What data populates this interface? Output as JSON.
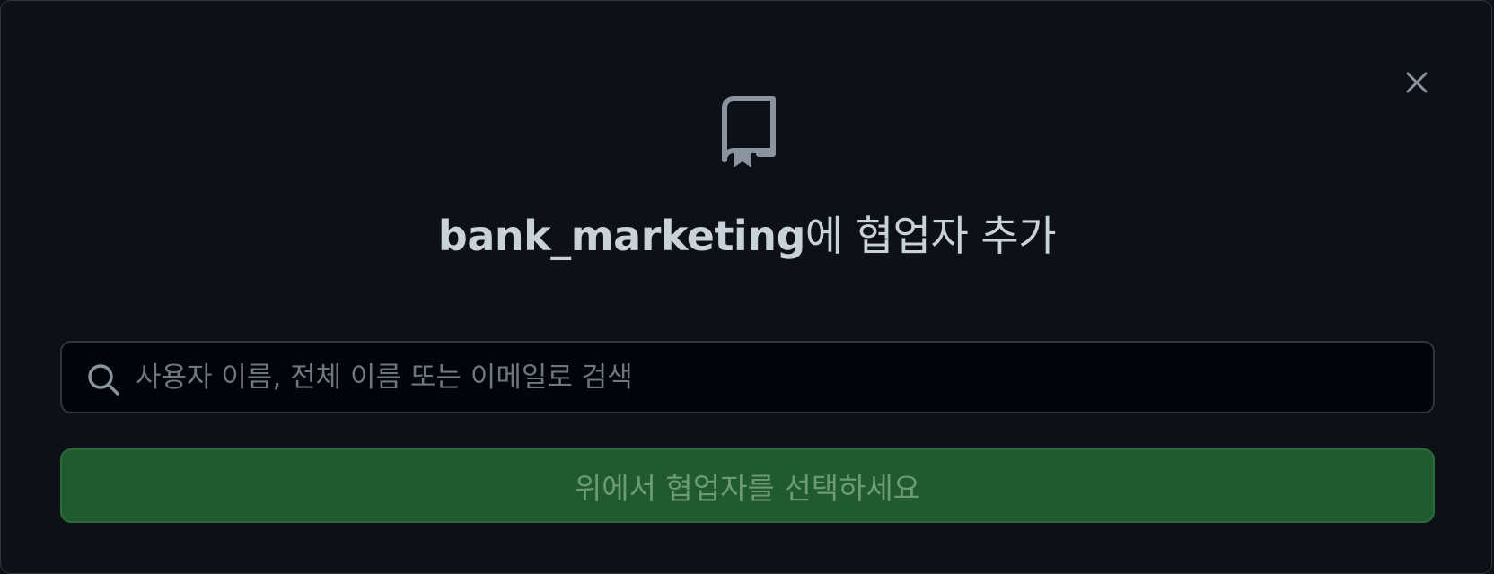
{
  "dialog": {
    "title_repo": "bank_marketing",
    "title_suffix": "에 협업자 추가",
    "close_icon": "x-icon",
    "header_icon": "repo-book-icon"
  },
  "search": {
    "placeholder": "사용자 이름, 전체 이름 또는 이메일로 검색",
    "value": "",
    "icon": "search-icon"
  },
  "submit": {
    "label": "위에서 협업자를 선택하세요",
    "enabled": false
  },
  "colors": {
    "background": "#0d1117",
    "border": "#30363d",
    "title_text": "#c9d1d9",
    "button_bg": "#215a2f",
    "button_text": "#6d9a76"
  }
}
